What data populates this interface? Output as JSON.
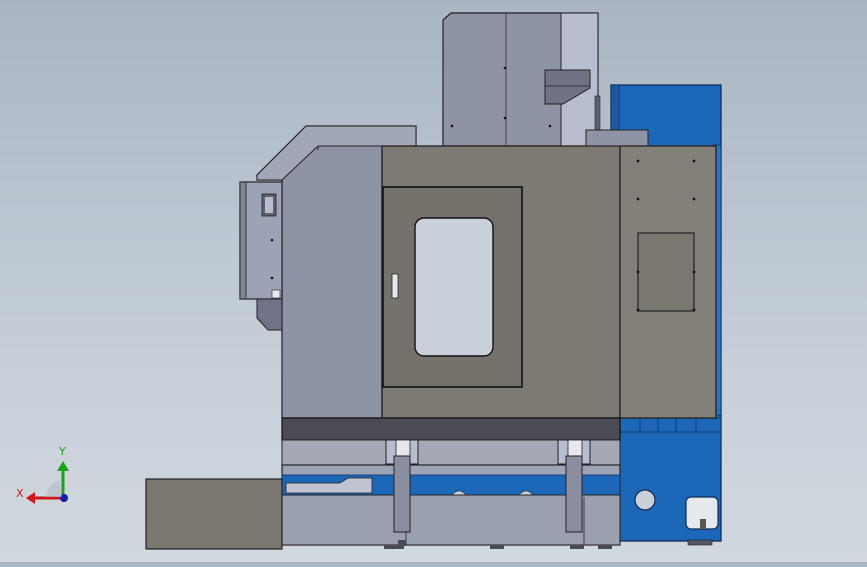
{
  "viewport": {
    "view": "front-view",
    "background_top": "#aab5c3",
    "background_bottom": "#d2d8df"
  },
  "model": {
    "name": "machining-center-enclosure",
    "colors": {
      "body_gray": "#7d7a74",
      "panel_slate": "#8e93a5",
      "trim_dark": "#4a4b55",
      "spindle_light": "#9da3b6",
      "machine_blue": "#1d67b8",
      "window_glass": "#c9d0da",
      "base_block": "#7a7670"
    }
  },
  "triad": {
    "x_label": "X",
    "y_label": "Y",
    "x_color": "#d01818",
    "y_color": "#1ea01e",
    "origin_color": "#1a1aa8"
  }
}
